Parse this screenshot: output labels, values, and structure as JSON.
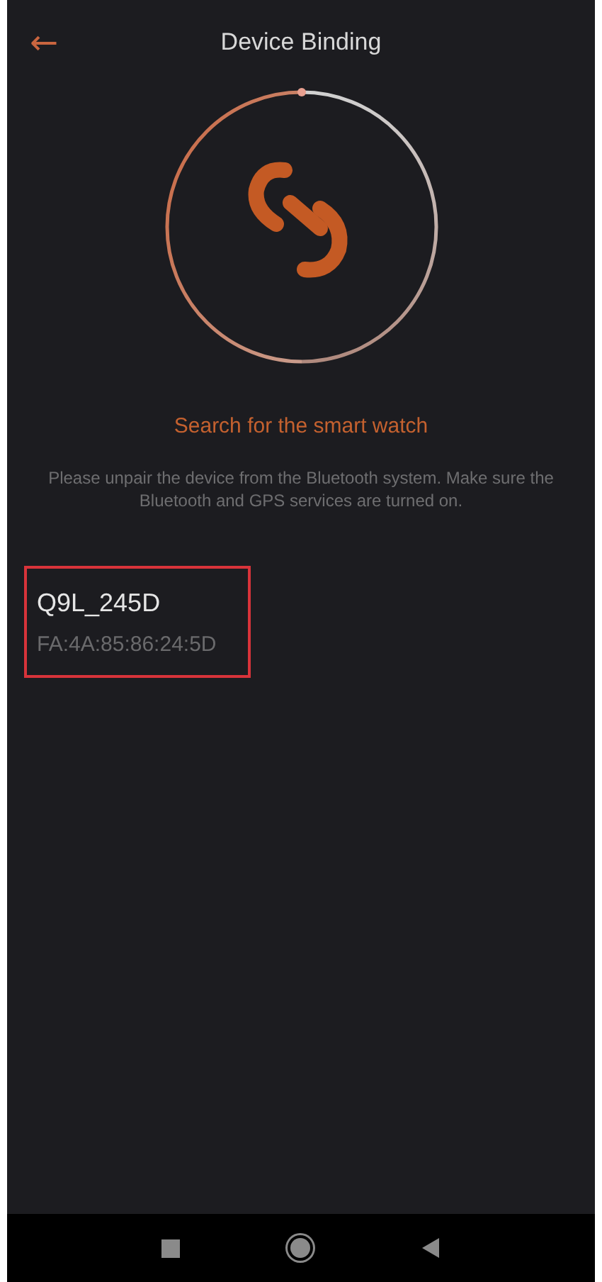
{
  "header": {
    "back": "←",
    "title": "Device Binding"
  },
  "status": "Search for the smart watch",
  "hint": "Please unpair the device from the Bluetooth system. Make sure the Bluetooth and GPS services are turned on.",
  "devices": [
    {
      "name": "Q9L_245D",
      "address": "FA:4A:85:86:24:5D",
      "highlighted": true
    }
  ]
}
